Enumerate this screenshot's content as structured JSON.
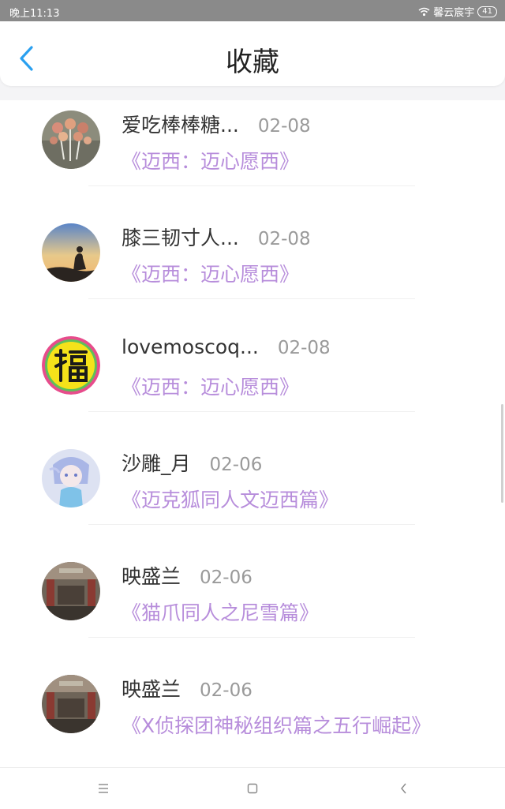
{
  "status": {
    "time": "晚上11:13",
    "carrier": "馨云宸宇",
    "battery": "41"
  },
  "header": {
    "title": "收藏"
  },
  "items": [
    {
      "name": "爱吃棒棒糖...",
      "date": "02-08",
      "book": "《迈西：迈心愿西》",
      "avatar": "lollipops"
    },
    {
      "name": "膝三韧寸人...",
      "date": "02-08",
      "book": "《迈西：迈心愿西》",
      "avatar": "sunset"
    },
    {
      "name": "lovemoscoq...",
      "date": "02-08",
      "book": "《迈西：迈心愿西》",
      "avatar": "fu"
    },
    {
      "name": "沙雕_月",
      "date": "02-06",
      "book": "《迈克狐同人文迈西篇》",
      "avatar": "anime"
    },
    {
      "name": "映盛兰",
      "date": "02-06",
      "book": "《猫爪同人之尼雪篇》",
      "avatar": "street"
    },
    {
      "name": "映盛兰",
      "date": "02-06",
      "book": "《X侦探团神秘组织篇之五行崛起》",
      "avatar": "street"
    }
  ],
  "colors": {
    "accent": "#2aa0f0",
    "book_title": "#b78ddb"
  }
}
